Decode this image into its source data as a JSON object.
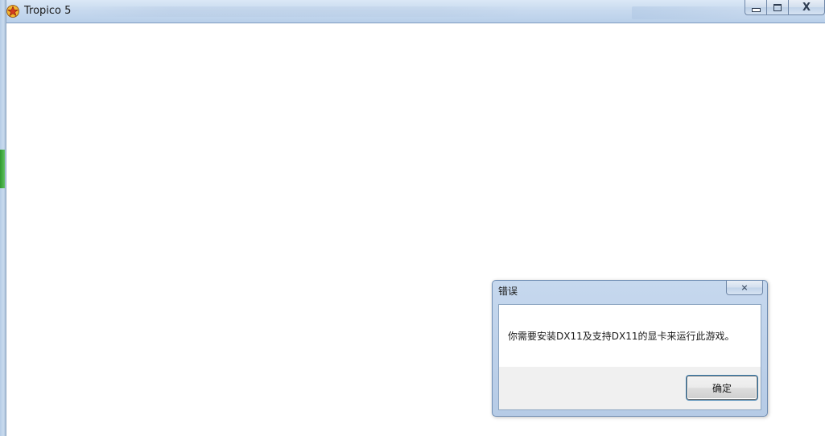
{
  "window": {
    "title": "Tropico 5",
    "icon": "tropico-star-icon",
    "controls": {
      "minimize": "minimize-icon",
      "maximize": "maximize-icon",
      "close_glyph": "X"
    }
  },
  "dialog": {
    "title": "错误",
    "close_glyph": "⨯",
    "message": "你需要安装DX11及支持DX11的显卡来运行此游戏。",
    "ok_label": "确定"
  },
  "colors": {
    "titlebar": "#c8daef",
    "dialog_frame": "#b6cbe6",
    "button_focus": "#3c7fb1",
    "icon_star": "#d23a1f",
    "icon_badge": "#f2b632"
  }
}
